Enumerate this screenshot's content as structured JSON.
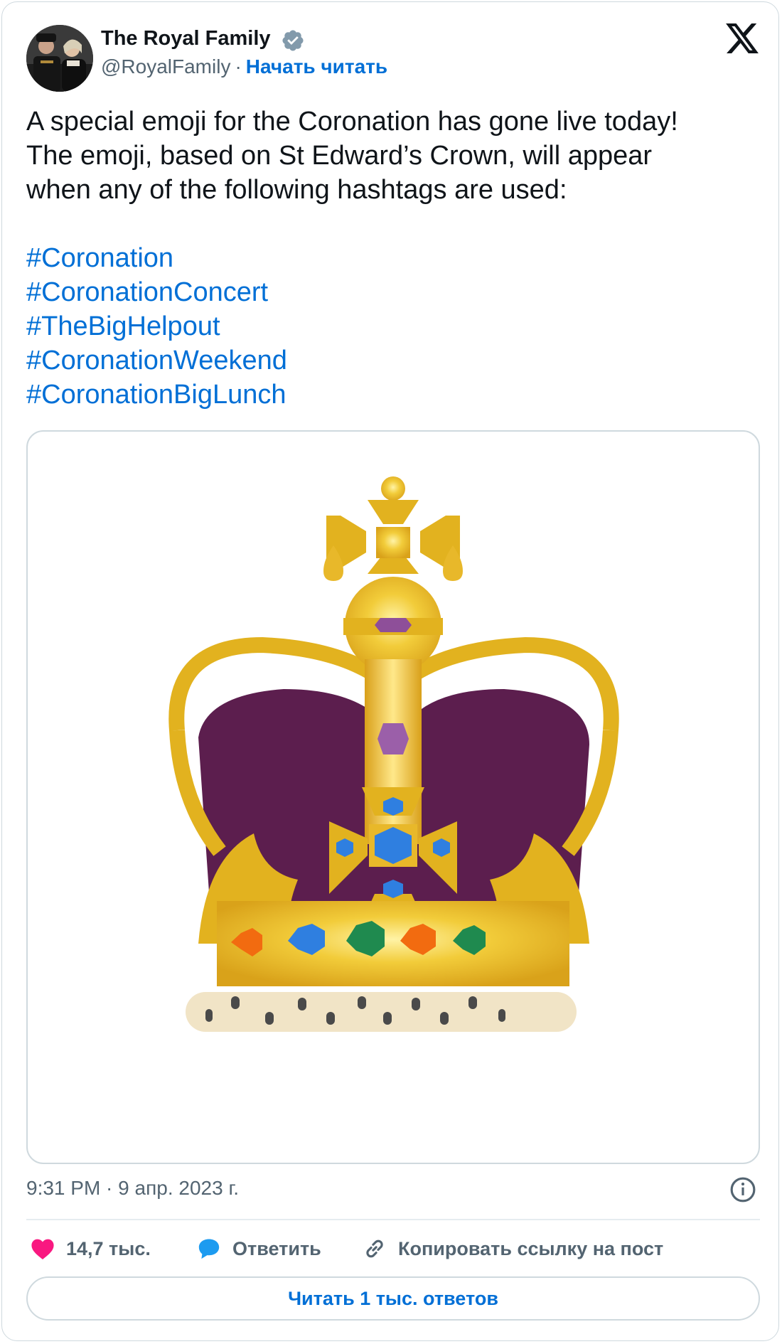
{
  "author": {
    "display_name": "The Royal Family",
    "handle": "@RoyalFamily",
    "separator": "·",
    "follow_label": "Начать читать",
    "verified_badge_color": "#829aab"
  },
  "brand_icon": "x-logo-icon",
  "tweet": {
    "text_lines": [
      "A special emoji for the Coronation has gone live today!",
      "The emoji, based on St Edward’s Crown, will appear",
      "when any of the following hashtags are used:"
    ],
    "hashtags": [
      "#Coronation",
      "#CoronationConcert",
      "#TheBigHelpout",
      "#CoronationWeekend",
      "#CoronationBigLunch"
    ],
    "media_description_icon": "crown-emoji-image"
  },
  "meta": {
    "timestamp": "9:31 PM · 9 апр. 2023 г."
  },
  "actions": {
    "like_count": "14,7 тыс.",
    "reply_label": "Ответить",
    "copy_link_label": "Копировать ссылку на пост",
    "read_replies_label": "Читать 1 тыс. ответов"
  },
  "colors": {
    "link_blue": "#006fd6",
    "like_pink": "#f91880",
    "reply_blue": "#1d9bf0",
    "muted_text": "#536471",
    "border": "#cfd9de",
    "crown_gold": "#e2b21f",
    "crown_velvet": "#5c1e4e"
  }
}
